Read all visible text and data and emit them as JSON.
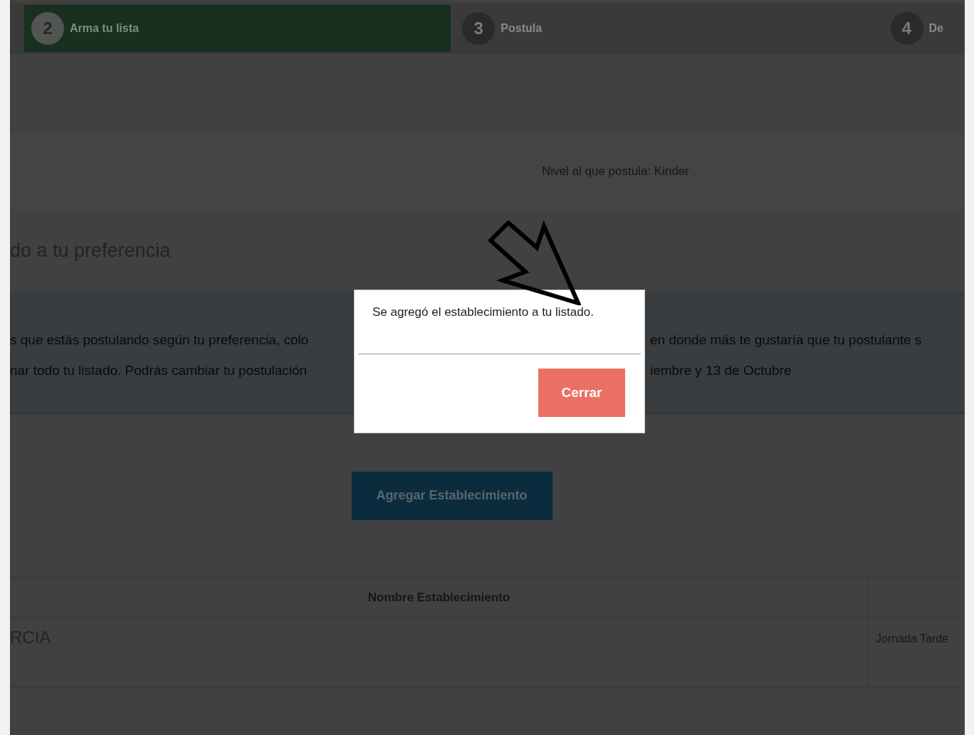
{
  "steps": [
    {
      "number": "2",
      "label": "Arma tu lista",
      "selected": true
    },
    {
      "number": "3",
      "label": "Postula",
      "selected": false
    },
    {
      "number": "4",
      "label": "De",
      "selected": false
    }
  ],
  "level_line": "Nivel al que postula: Kinder",
  "heading": "do a tu preferencia",
  "info": {
    "line_1_left": "s que estás postulando según tu preferencia, colo",
    "line_1_right": "en donde más te gustaría que tu postulante s",
    "line_2_left": "nar todo tu listado. Podrás cambiar tu postulación",
    "line_2_right": "iembre y 13 de Octubre"
  },
  "add_button": "Agregar Establecimiento",
  "table": {
    "columns": [
      "Nombre Establecimiento"
    ],
    "rows": [
      {
        "name": "RCIA",
        "shift": "Jornada Tarde"
      }
    ]
  },
  "dialog": {
    "message": "Se agregó el establecimiento a tu listado.",
    "button": "Cerrar"
  }
}
